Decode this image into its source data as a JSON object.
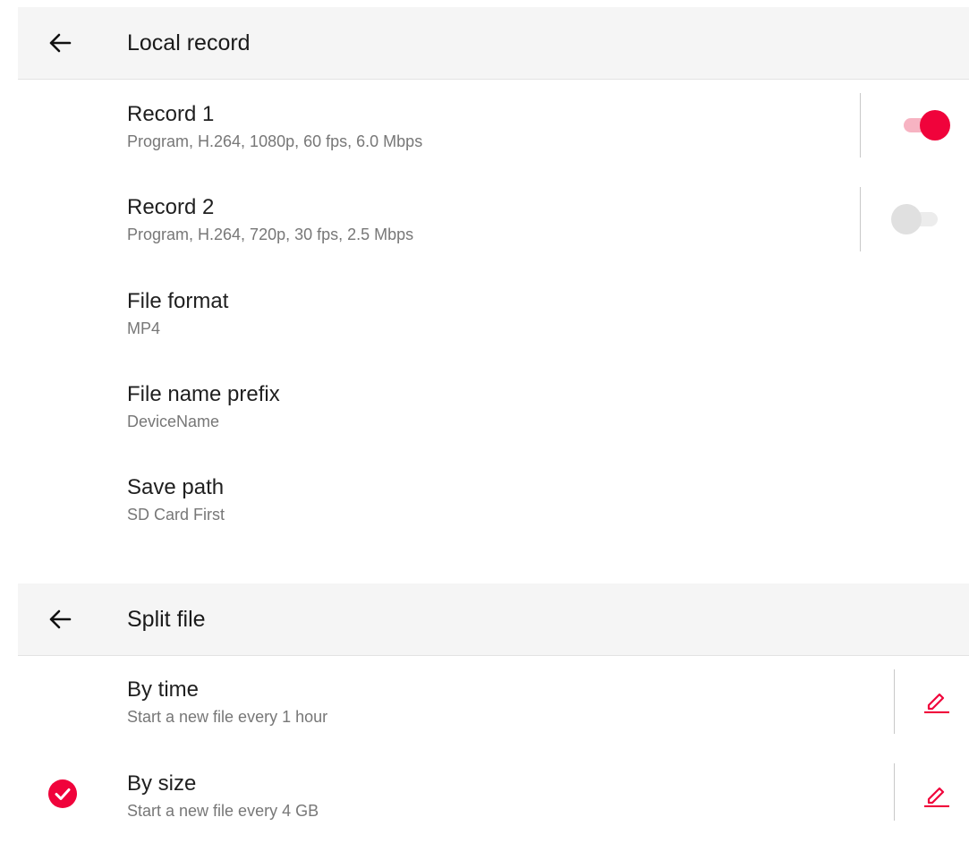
{
  "local_record": {
    "title": "Local record",
    "back_icon": "arrow-left-icon",
    "items": [
      {
        "label": "Record 1",
        "sub": "Program, H.264, 1080p, 60 fps, 6.0 Mbps",
        "enabled": true
      },
      {
        "label": "Record 2",
        "sub": "Program, H.264, 720p, 30 fps, 2.5 Mbps",
        "enabled": false
      },
      {
        "label": "File format",
        "sub": "MP4"
      },
      {
        "label": "File name prefix",
        "sub": "DeviceName"
      },
      {
        "label": "Save path",
        "sub": "SD Card First"
      }
    ]
  },
  "split_file": {
    "title": "Split file",
    "back_icon": "arrow-left-icon",
    "items": [
      {
        "label": "By time",
        "sub": "Start a new file every 1 hour",
        "selected": false,
        "action_icon": "edit-pencil-icon"
      },
      {
        "label": "By size",
        "sub": "Start a new file every 4 GB",
        "selected": true,
        "action_icon": "edit-pencil-icon"
      }
    ]
  },
  "colors": {
    "accent": "#f0033b",
    "header_bg": "#f5f5f5",
    "subtitle": "#777777"
  }
}
